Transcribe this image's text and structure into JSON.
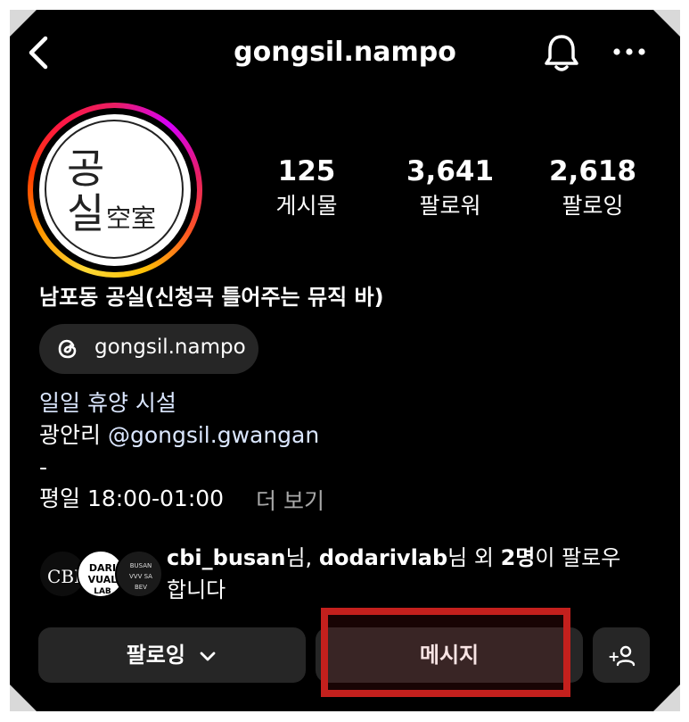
{
  "header": {
    "username": "gongsil.nampo"
  },
  "avatar": {
    "logo_top": "공",
    "logo_mid": "실",
    "logo_hanja": "空室"
  },
  "stats": [
    {
      "value": "125",
      "label": "게시물"
    },
    {
      "value": "3,641",
      "label": "팔로워"
    },
    {
      "value": "2,618",
      "label": "팔로잉"
    }
  ],
  "profile": {
    "display_name": "남포동 공실(신청곡 틀어주는 뮤직 바)",
    "threads_handle": "gongsil.nampo",
    "bio": {
      "line1": "일일 휴양 시설",
      "line2_prefix": "광안리 ",
      "line2_mention": "@gongsil.gwangan",
      "line3": "-",
      "line4": "평일 18:00-01:00",
      "more": "더 보기"
    }
  },
  "mutual": {
    "user1": "cbi_busan",
    "sep1": "님, ",
    "user2": "dodarivlab",
    "sep2": "님 외 ",
    "count": "2명",
    "suffix": "이 팔로우",
    "line2": "합니다"
  },
  "actions": {
    "following_label": "팔로잉",
    "message_label": "메시지",
    "add_label": "+"
  },
  "colors": {
    "background": "#000000",
    "button": "#262626",
    "highlight": "#c4201d",
    "link": "#dbe7ff"
  }
}
